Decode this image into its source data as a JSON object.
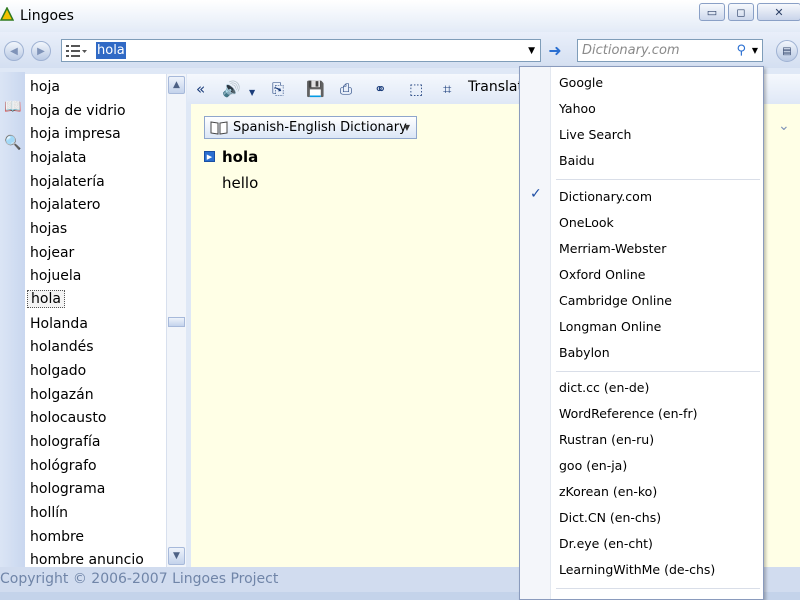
{
  "window": {
    "title": "Lingoes",
    "controls": {
      "minimize": "▭",
      "restore": "◻",
      "close": "✕"
    }
  },
  "toolbar": {
    "search_value": "hola",
    "engine_placeholder": "Dictionary.com"
  },
  "word_list": [
    "hoja",
    "hoja de vidrio",
    "hoja impresa",
    "hojalata",
    "hojalatería",
    "hojalatero",
    "hojas",
    "hojear",
    "hojuela",
    "hola",
    "Holanda",
    "holandés",
    "holgado",
    "holgazán",
    "holocausto",
    "holografía",
    "hológrafo",
    "holograma",
    "hollín",
    "hombre",
    "hombre anuncio"
  ],
  "selected_word": "hola",
  "content_toolbar": {
    "translate_label": "Translat"
  },
  "dictionary": {
    "name": "Spanish-English Dictionary",
    "headword": "hola",
    "definition": "hello"
  },
  "status": {
    "copyright": "Copyright © 2006-2007 Lingoes Project"
  },
  "engine_menu": {
    "groups": [
      [
        "Google",
        "Yahoo",
        "Live Search",
        "Baidu"
      ],
      [
        "Dictionary.com",
        "OneLook",
        "Merriam-Webster",
        "Oxford Online",
        "Cambridge Online",
        "Longman Online",
        "Babylon"
      ],
      [
        "dict.cc (en-de)",
        "WordReference (en-fr)",
        "Rustran (en-ru)",
        "goo (en-ja)",
        "zKorean (en-ko)",
        "Dict.CN (en-chs)",
        "Dr.eye (en-cht)",
        "LearningWithMe (de-chs)"
      ]
    ],
    "checked": "Dictionary.com"
  },
  "colors": {
    "accent": "#316ac5",
    "content_bg": "#ffffe6",
    "chrome": "#dfe8f6"
  }
}
